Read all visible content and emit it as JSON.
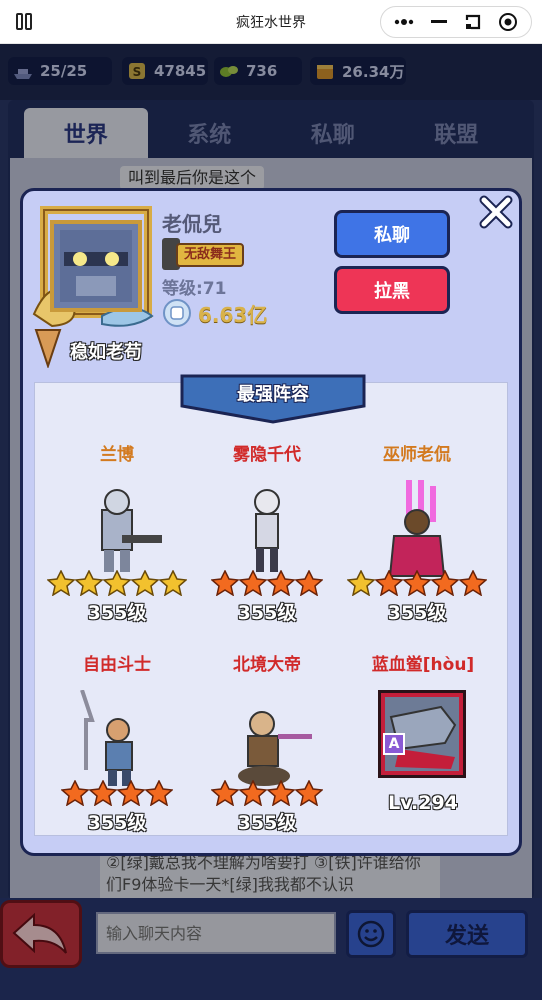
{
  "app": {
    "title": "疯狂水世界"
  },
  "resources": [
    {
      "icon": "ship-icon",
      "value": "25/25"
    },
    {
      "icon": "stamina-icon",
      "value": "47845"
    },
    {
      "icon": "gem-icon",
      "value": "736"
    },
    {
      "icon": "gold-icon",
      "value": "26.34万"
    }
  ],
  "tabs": [
    "世界",
    "系统",
    "私聊",
    "联盟"
  ],
  "chat": {
    "visible_message": "叫到最后你是这个",
    "bottom_message": "②[绿]戴总我不理解为啥要打 ③[铁]许谁给你们F9体验卡一天*[绿]我我都不认识",
    "input_placeholder": "输入聊天内容",
    "send_label": "发送"
  },
  "profile": {
    "nickname": "老侃兒",
    "rank_title": "无敌舞王",
    "level_label": "等级:71",
    "power": "6.63亿",
    "frame_title": "稳如老苟",
    "private_chat_label": "私聊",
    "block_label": "拉黑"
  },
  "lineup": {
    "banner": "最强阵容",
    "heroes": [
      {
        "name": "兰博",
        "name_color": "orange",
        "stars": 5,
        "star_color": "gold",
        "level": "355级"
      },
      {
        "name": "雾隐千代",
        "name_color": "red",
        "stars": 4,
        "star_color": "red",
        "level": "355级"
      },
      {
        "name": "巫师老侃",
        "name_color": "orange",
        "stars": 5,
        "star_color": "mixed",
        "level": "355级"
      },
      {
        "name": "自由斗士",
        "name_color": "red",
        "stars": 4,
        "star_color": "red",
        "level": "355级"
      },
      {
        "name": "北境大帝",
        "name_color": "red",
        "stars": 4,
        "star_color": "red",
        "level": "355级"
      }
    ],
    "card": {
      "name": "蓝血鲎[hòu]",
      "rarity": "A",
      "level": "Lv.294"
    }
  }
}
